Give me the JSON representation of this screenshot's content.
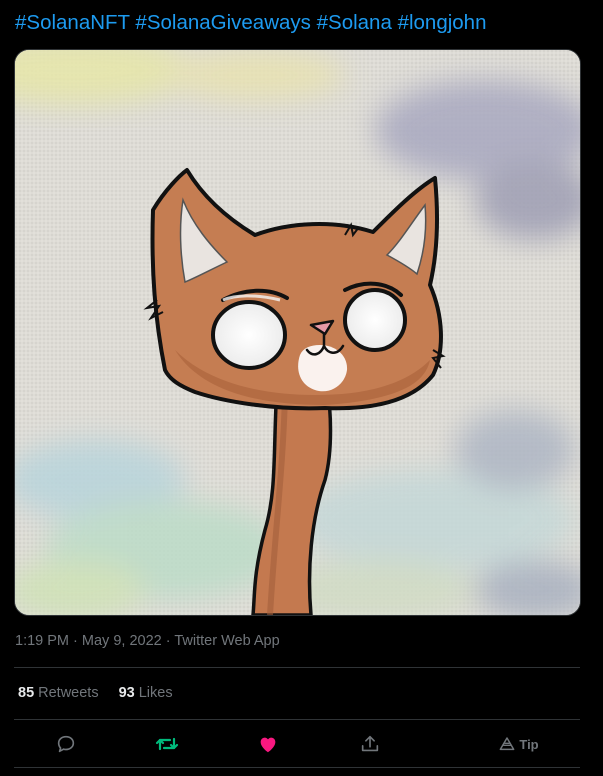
{
  "tweet": {
    "hashtags": [
      "#SolanaNFT",
      "#SolanaGiveaways",
      "#Solana",
      "#longjohn"
    ],
    "time": "1:19 PM",
    "date": "May 9, 2022",
    "source": "Twitter Web App",
    "separator": "·"
  },
  "stats": {
    "retweets_count": "85",
    "retweets_label": "Retweets",
    "likes_count": "93",
    "likes_label": "Likes"
  },
  "actions": {
    "tip_label": "Tip",
    "icons": [
      "reply-icon",
      "retweet-icon",
      "like-icon",
      "share-icon",
      "tip-icon"
    ],
    "retweet_color": "#00ba7c",
    "like_color": "#f91880"
  },
  "colors": {
    "background": "#000000",
    "link": "#1d9bf0",
    "secondary_text": "#71767b",
    "divider": "#2f3336"
  }
}
